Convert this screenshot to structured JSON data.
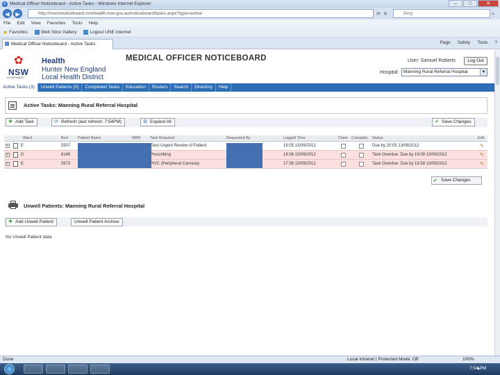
{
  "browser": {
    "window_title": "Medical Officer Noticeboard - Active Tasks - Windows Internet Explorer",
    "address": "http://mononoticeboard.mrehealth.nsw.gov.au/noticeboard/tasks.aspx?type=active",
    "search_placeholder": "Bing",
    "menu": [
      "File",
      "Edit",
      "View",
      "Favorites",
      "Tools",
      "Help"
    ],
    "favorites_label": "Favorites",
    "favorite_links": [
      "Web Slice Gallery",
      "Logout UNE Internet"
    ],
    "tab_title": "Medical Officer Noticeboard - Active Tasks",
    "command_bar": [
      "Page",
      "Safety",
      "Tools",
      "?"
    ],
    "status_left": "Done",
    "status_zone": "Local intranet | Protected Mode: Off",
    "zoom": "100%",
    "clock": "7:54 PM"
  },
  "header": {
    "logo_text": "NSW",
    "logo_sub": "GOVERNMENT",
    "org_line1": "Health",
    "org_line2": "Hunter New England",
    "org_line3": "Local Health District",
    "app_title": "MEDICAL OFFICER NOTICEBOARD",
    "user_label": "User: Samuel Roberts",
    "logout_label": "Log Out",
    "hospital_label": "Hospital:",
    "hospital_value": "Manning Rural Referral Hospital"
  },
  "nav": {
    "items": [
      "Active Tasks (3)",
      "Unwell Patients (0)",
      "Completed Tasks",
      "Education",
      "Rosters",
      "Search",
      "Directory",
      "Help"
    ],
    "active_index": 0
  },
  "active_tasks": {
    "title": "Active Tasks: Manning Rural Referral Hospital",
    "toolbar": {
      "add": "Add Task",
      "refresh": "Refresh (last refresh: 7:54PM)",
      "expand": "Expand All",
      "save": "Save Changes"
    },
    "columns": [
      "Ward",
      "Bed",
      "Patient Name",
      "MRN",
      "Task Required",
      "Requested By",
      "Logged Time",
      "Claim",
      "Complete",
      "Status",
      "Edit"
    ],
    "rows": [
      {
        "ward": "E",
        "bed": "5507",
        "task": "Elect Urgent Review of Patient",
        "logged": "19:05 13/09/2012",
        "status": "Due by 20:05 13/09/2012"
      },
      {
        "ward": "D",
        "bed": "6145",
        "task": "Prescribing",
        "logged": "18:08 13/09/2012",
        "status": "Task Overdue: Due by 19:08 13/09/2012"
      },
      {
        "ward": "E",
        "bed": "5573",
        "task": "PIVC (Peripheral Cannula)",
        "logged": "17:58 13/09/2012",
        "status": "Task Overdue: Due by 18:58 13/09/2012"
      }
    ]
  },
  "unwell": {
    "title": "Unwell Patients: Manning Rural Referral Hospital",
    "add": "Add Unwell Patient",
    "archive": "Unwell Patient Archive",
    "empty": "No Unwell Patient data"
  }
}
